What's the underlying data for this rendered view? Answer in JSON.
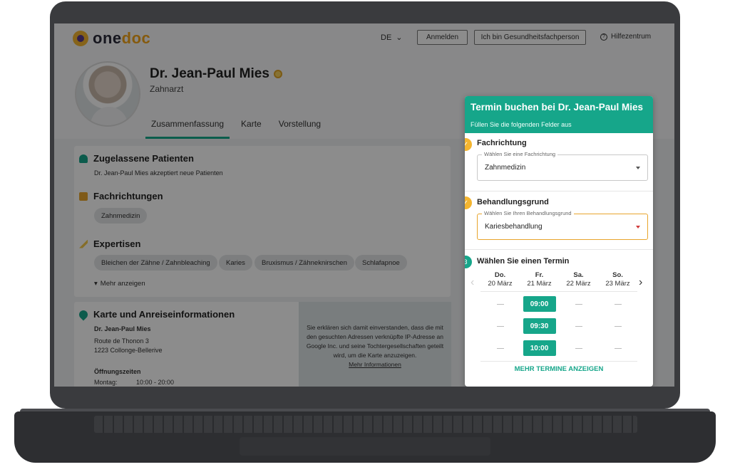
{
  "header": {
    "logo_text_1": "one",
    "logo_text_2": "doc",
    "language": "DE",
    "login_button": "Anmelden",
    "professional_button": "Ich bin Gesundheitsfachperson",
    "help_link": "Hilfezentrum"
  },
  "profile": {
    "name": "Dr. Jean-Paul Mies",
    "specialty": "Zahnarzt",
    "tabs": [
      "Zusammenfassung",
      "Karte",
      "Vorstellung"
    ]
  },
  "summary": {
    "patients_title": "Zugelassene Patienten",
    "patients_text": "Dr. Jean-Paul Mies akzeptiert neue Patienten",
    "specialties_title": "Fachrichtungen",
    "specialty_chip": "Zahnmedizin",
    "expertise_title": "Expertisen",
    "expertise_chips": [
      "Bleichen der Zähne / Zahnbleaching",
      "Karies",
      "Bruxismus / Zähneknirschen",
      "Schlafapnoe"
    ],
    "show_more": "Mehr anzeigen"
  },
  "map_section": {
    "title": "Karte und Anreiseinformationen",
    "doctor": "Dr. Jean-Paul Mies",
    "street": "Route de Thonon 3",
    "city": "1223 Collonge-Bellerive",
    "hours_title": "Öffnungszeiten",
    "hours_day": "Montag:",
    "hours_time": "10:00 - 20:00",
    "consent_text": "Sie erklären sich damit einverstanden, dass die mit den gesuchten Adressen verknüpfte IP-Adresse an Google Inc. und seine Tochtergesellschaften geteilt wird, um die Karte anzuzeigen.",
    "consent_link": "Mehr Informationen"
  },
  "booking": {
    "title": "Termin buchen bei Dr. Jean-Paul Mies",
    "subtitle": "Füllen Sie die folgenden Felder aus",
    "step1_label": "Fachrichtung",
    "step1_legend": "Wählen Sie eine Fachrichtung",
    "step1_value": "Zahnmedizin",
    "step2_label": "Behandlungsgrund",
    "step2_legend": "Wählen Sie Ihren Behandlungsgrund",
    "step2_value": "Kariesbehandlung",
    "step3_number": "3",
    "step3_label": "Wählen Sie einen Termin",
    "days": [
      {
        "name": "Do.",
        "date": "20 März"
      },
      {
        "name": "Fr.",
        "date": "21 März"
      },
      {
        "name": "Sa.",
        "date": "22 März"
      },
      {
        "name": "So.",
        "date": "23 März"
      }
    ],
    "slots": [
      "09:00",
      "09:30",
      "10:00"
    ],
    "more_slots": "MEHR TERMINE ANZEIGEN"
  },
  "colors": {
    "brand_green": "#16a68a",
    "accent_orange": "#f4b530"
  }
}
